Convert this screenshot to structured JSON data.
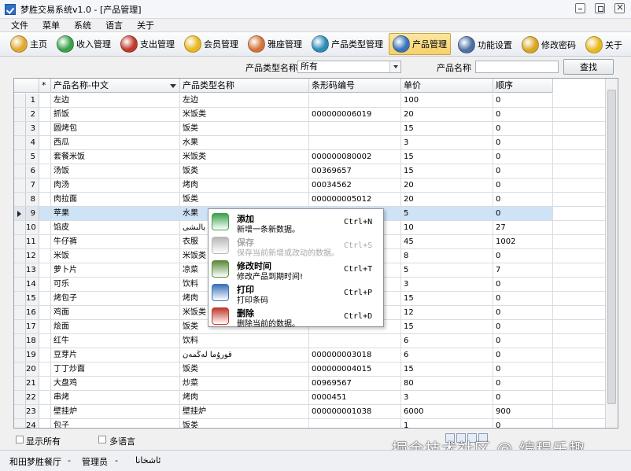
{
  "window": {
    "title": "梦胜交易系统v1.0 - [产品管理]"
  },
  "menu": [
    "文件",
    "菜单",
    "系统",
    "语言",
    "关于"
  ],
  "toolbar": {
    "items": [
      {
        "label": "主页",
        "icon": "home-icon",
        "color": "#e0a82f"
      },
      {
        "label": "收入管理",
        "icon": "income-icon",
        "color": "#3aa14a"
      },
      {
        "label": "支出管理",
        "icon": "expense-icon",
        "color": "#c0392b"
      },
      {
        "label": "会员管理",
        "icon": "member-icon",
        "color": "#e8b820"
      },
      {
        "label": "雅座管理",
        "icon": "seat-icon",
        "color": "#d4743a"
      },
      {
        "label": "产品类型管理",
        "icon": "gear-icon",
        "color": "#2e8bb7"
      },
      {
        "label": "产品管理",
        "icon": "product-icon",
        "color": "#3b73b9"
      }
    ],
    "right": [
      {
        "label": "功能设置",
        "icon": "tools-icon",
        "color": "#4a6fa5"
      },
      {
        "label": "修改密码",
        "icon": "lock-icon",
        "color": "#d9a520"
      },
      {
        "label": "关于",
        "icon": "info-icon",
        "color": "#e8b820"
      }
    ]
  },
  "filter": {
    "type_label": "产品类型名称",
    "type_value": "所有",
    "name_label": "产品名称",
    "name_value": "",
    "search_button": "查找"
  },
  "grid": {
    "columns": [
      "*",
      "产品名称-中文",
      "产品类型名称",
      "条形码编号",
      "单价",
      "顺序"
    ],
    "rows": [
      [
        "1",
        "左边",
        "左边",
        "",
        "100",
        "0"
      ],
      [
        "2",
        "抓饭",
        "米饭类",
        "000000006019",
        "20",
        "0"
      ],
      [
        "3",
        "圆烤包",
        "饭类",
        "",
        "15",
        "0"
      ],
      [
        "4",
        "西瓜",
        "水果",
        "",
        "3",
        "0"
      ],
      [
        "5",
        "套餐米饭",
        "米饭类",
        "000000080002",
        "15",
        "0"
      ],
      [
        "6",
        "汤饭",
        "饭类",
        "00369657",
        "15",
        "0"
      ],
      [
        "7",
        "肉汤",
        "烤肉",
        "00034562",
        "20",
        "0"
      ],
      [
        "8",
        "肉拉面",
        "饭类",
        "000000005012",
        "20",
        "0"
      ],
      [
        "9",
        "苹果",
        "水果",
        "",
        "5",
        "0"
      ],
      [
        "10",
        "馅皮",
        "بالىشى",
        "",
        "10",
        "27"
      ],
      [
        "11",
        "牛仔裤",
        "衣服",
        "",
        "45",
        "1002"
      ],
      [
        "12",
        "米饭",
        "米饭类",
        "",
        "8",
        "0"
      ],
      [
        "13",
        "萝卜片",
        "凉菜",
        "",
        "5",
        "7"
      ],
      [
        "14",
        "可乐",
        "饮料",
        "",
        "3",
        "0"
      ],
      [
        "15",
        "烤包子",
        "烤肉",
        "",
        "15",
        "0"
      ],
      [
        "16",
        "鸡面",
        "米饭类",
        "",
        "12",
        "0"
      ],
      [
        "17",
        "烩面",
        "饭类",
        "",
        "15",
        "0"
      ],
      [
        "18",
        "红牛",
        "饮料",
        "",
        "6",
        "0"
      ],
      [
        "19",
        "豆芽片",
        "قورۇما لەڭمەن",
        "000000003018",
        "6",
        "0"
      ],
      [
        "20",
        "丁丁炒面",
        "饭类",
        "000000004015",
        "15",
        "0"
      ],
      [
        "21",
        "大盘鸡",
        "炒菜",
        "00969567",
        "80",
        "0"
      ],
      [
        "22",
        "串烤",
        "烤肉",
        "0000451",
        "3",
        "0"
      ],
      [
        "23",
        "壁挂炉",
        "壁挂炉",
        "000000001038",
        "6000",
        "900"
      ],
      [
        "24",
        "包子",
        "饭类",
        "",
        "1",
        "0"
      ]
    ],
    "selected_row": 9
  },
  "context_menu": [
    {
      "title": "添加",
      "desc": "新增一条新数据。",
      "shortcut": "Ctrl+N",
      "icon": "add-icon",
      "color": "#3aa14a",
      "disabled": false
    },
    {
      "title": "保存",
      "desc": "保存当前新增或改动的数据。",
      "shortcut": "Ctrl+S",
      "icon": "save-icon",
      "color": "#b8b8b8",
      "disabled": true
    },
    {
      "title": "修改时间",
      "desc": "修改产品到期时间!",
      "shortcut": "Ctrl+T",
      "icon": "clock-icon",
      "color": "#5a8a3a",
      "disabled": false
    },
    {
      "title": "打印",
      "desc": "打印条码",
      "shortcut": "Ctrl+P",
      "icon": "printer-icon",
      "color": "#3b73b9",
      "disabled": false
    },
    {
      "title": "删除",
      "desc": "删除当前的数据。",
      "shortcut": "Ctrl+D",
      "icon": "delete-icon",
      "color": "#c0392b",
      "disabled": false
    }
  ],
  "bottom": {
    "show_all_label": "显示所有",
    "multilang_label": "多语言",
    "watermark": "掘金技术社区 @ 编程乐趣"
  },
  "status": {
    "store": "和田梦胜餐厅",
    "sep1": "-",
    "user": "管理员",
    "sep2": "-",
    "lang": "ئاشخانا"
  }
}
